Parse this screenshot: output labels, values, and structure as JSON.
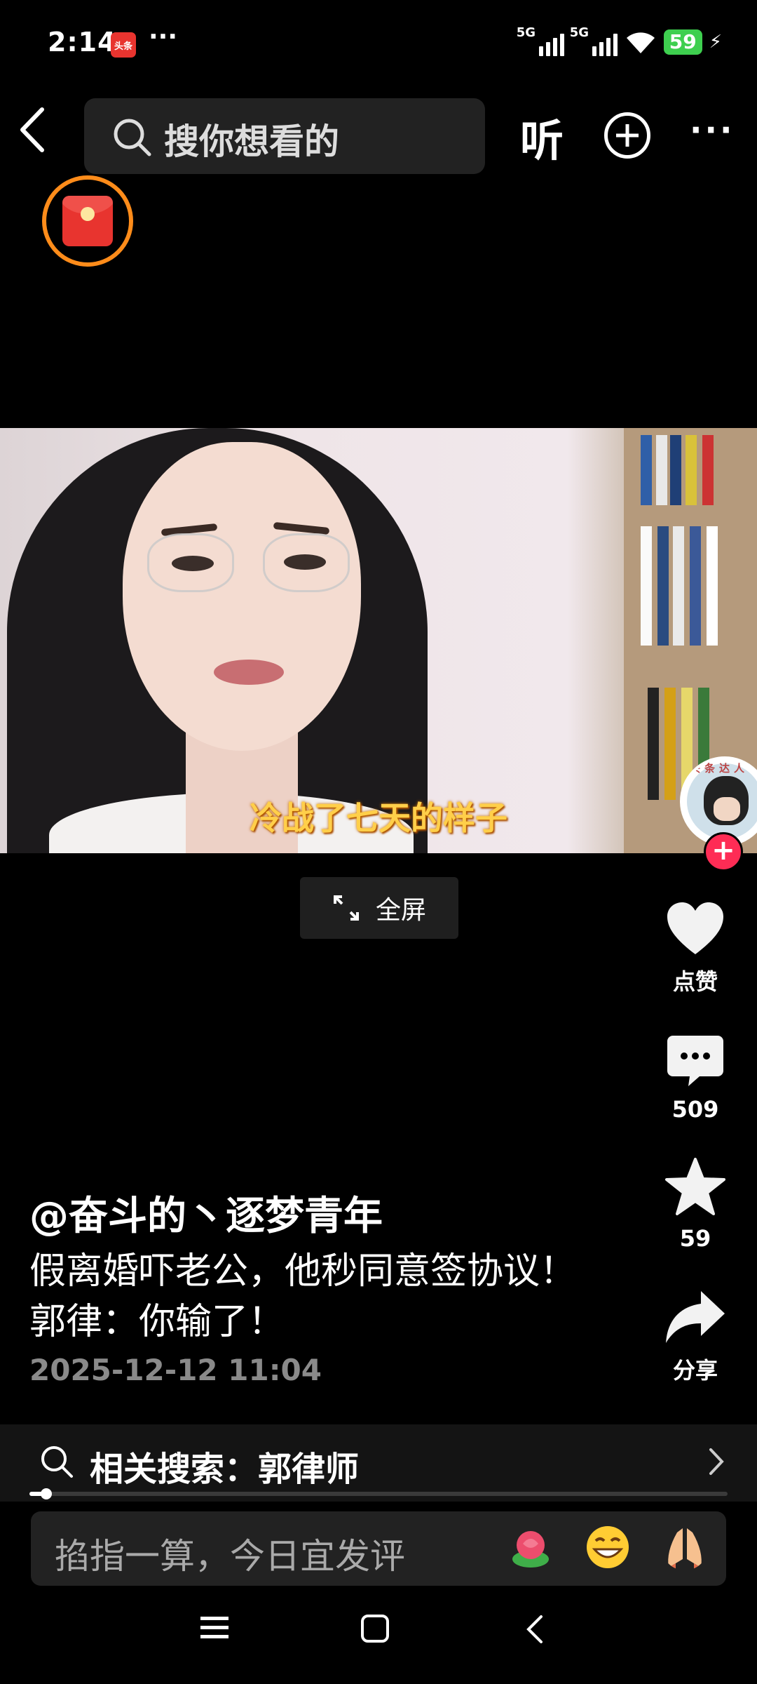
{
  "status_bar": {
    "time": "2:14",
    "app_badge": "头条",
    "dots": "···",
    "network_1": "5G",
    "network_2": "5G",
    "battery": "59"
  },
  "top_bar": {
    "search_placeholder": "搜你想看的",
    "listen_label": "听"
  },
  "video": {
    "subtitle": "冷战了七天的样子",
    "avatar_tag": "头条达人",
    "fullscreen_label": "全屏"
  },
  "actions": {
    "like_label": "点赞",
    "comment_count": "509",
    "favorite_count": "59",
    "share_label": "分享"
  },
  "post": {
    "author": "@奋斗的丶逐梦青年",
    "description_line1": "假离婚吓老公，他秒同意签协议！",
    "description_line2": "郭律：你输了！",
    "date": "2025-12-12 11:04"
  },
  "related_search": {
    "text": "相关搜索：郭律师"
  },
  "playback": {
    "progress": 0.02
  },
  "comment_bar": {
    "placeholder": "掐指一算，今日宜发评"
  },
  "colors": {
    "accent_red": "#fe2c55",
    "redpacket_ring": "#ff8c1a",
    "subtitle_yellow": "#ffcf4a",
    "battery_green": "#3ecf4f"
  }
}
